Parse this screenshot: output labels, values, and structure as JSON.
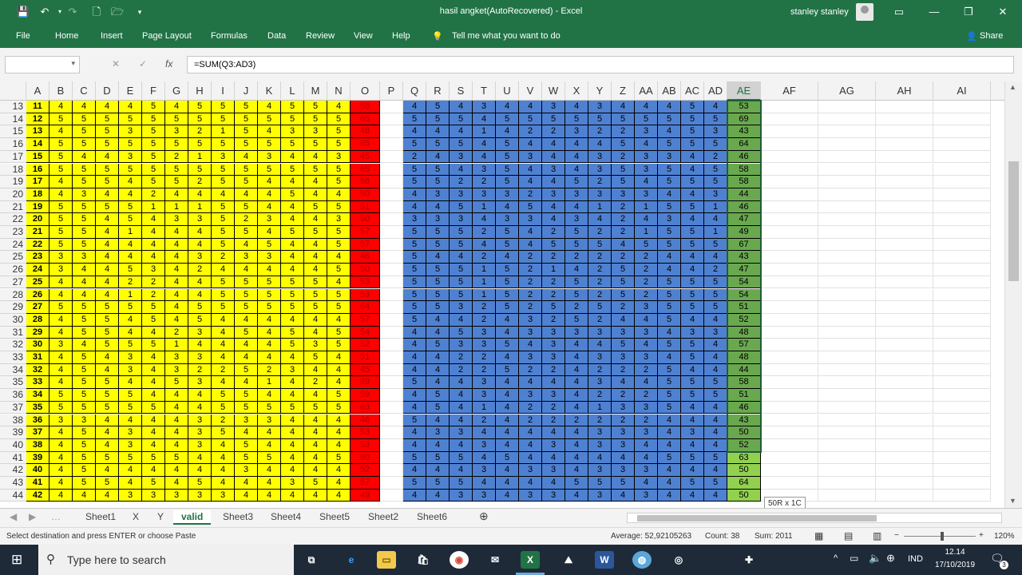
{
  "app": {
    "title": "hasil angket(AutoRecovered)  -  Excel",
    "user": "stanley stanley"
  },
  "ribbon": {
    "tabs": [
      "File",
      "Home",
      "Insert",
      "Page Layout",
      "Formulas",
      "Data",
      "Review",
      "View",
      "Help"
    ],
    "tell_me": "Tell me what you want to do",
    "share": "Share"
  },
  "formula_bar": {
    "name_box": "",
    "formula": "=SUM(Q3:AD3)"
  },
  "columns": [
    "A",
    "B",
    "C",
    "D",
    "E",
    "F",
    "G",
    "H",
    "I",
    "J",
    "K",
    "L",
    "M",
    "N",
    "O",
    "P",
    "Q",
    "R",
    "S",
    "T",
    "U",
    "V",
    "W",
    "X",
    "Y",
    "Z",
    "AA",
    "AB",
    "AC",
    "AD",
    "AE",
    "AF",
    "AG",
    "AH",
    "AI"
  ],
  "selected_column": "AE",
  "rows": [
    {
      "r": "13",
      "id": "11",
      "a": [
        4,
        4,
        4,
        4,
        5,
        4,
        5,
        5,
        5,
        4,
        5,
        5,
        4
      ],
      "o": "58",
      "b": [
        4,
        5,
        4,
        3,
        4,
        4,
        3,
        4,
        3,
        4,
        4,
        4,
        5,
        4
      ],
      "ae": "53"
    },
    {
      "r": "14",
      "id": "12",
      "a": [
        5,
        5,
        5,
        5,
        5,
        5,
        5,
        5,
        5,
        5,
        5,
        5,
        5
      ],
      "o": "65",
      "b": [
        5,
        5,
        5,
        4,
        5,
        5,
        5,
        5,
        5,
        5,
        5,
        5,
        5,
        5
      ],
      "ae": "69"
    },
    {
      "r": "15",
      "id": "13",
      "a": [
        4,
        5,
        5,
        3,
        5,
        3,
        2,
        1,
        5,
        4,
        3,
        3,
        5
      ],
      "o": "48",
      "b": [
        4,
        4,
        4,
        1,
        4,
        2,
        2,
        3,
        2,
        2,
        3,
        4,
        5,
        3
      ],
      "ae": "43"
    },
    {
      "r": "16",
      "id": "14",
      "a": [
        5,
        5,
        5,
        5,
        5,
        5,
        5,
        5,
        5,
        5,
        5,
        5,
        5
      ],
      "o": "65",
      "b": [
        5,
        5,
        5,
        4,
        5,
        4,
        4,
        4,
        4,
        5,
        4,
        5,
        5,
        5
      ],
      "ae": "64"
    },
    {
      "r": "17",
      "id": "15",
      "a": [
        5,
        4,
        4,
        3,
        5,
        2,
        1,
        3,
        4,
        3,
        4,
        4,
        3
      ],
      "o": "45",
      "b": [
        2,
        4,
        3,
        4,
        5,
        3,
        4,
        4,
        3,
        2,
        3,
        3,
        4,
        2
      ],
      "ae": "46"
    },
    {
      "r": "18",
      "id": "16",
      "a": [
        5,
        5,
        5,
        5,
        5,
        5,
        5,
        5,
        5,
        5,
        5,
        5,
        5
      ],
      "o": "65",
      "b": [
        5,
        5,
        4,
        3,
        5,
        4,
        3,
        4,
        3,
        5,
        3,
        5,
        4,
        5
      ],
      "ae": "58"
    },
    {
      "r": "19",
      "id": "17",
      "a": [
        4,
        5,
        5,
        4,
        5,
        5,
        2,
        5,
        5,
        4,
        4,
        4,
        5
      ],
      "o": "58",
      "b": [
        5,
        5,
        2,
        2,
        5,
        4,
        4,
        5,
        2,
        5,
        4,
        5,
        5,
        5
      ],
      "ae": "58"
    },
    {
      "r": "20",
      "id": "18",
      "a": [
        4,
        3,
        4,
        4,
        2,
        4,
        4,
        4,
        4,
        4,
        5,
        4,
        4
      ],
      "o": "50",
      "b": [
        4,
        3,
        3,
        3,
        3,
        2,
        3,
        3,
        3,
        3,
        3,
        4,
        4,
        3
      ],
      "ae": "44"
    },
    {
      "r": "21",
      "id": "19",
      "a": [
        5,
        5,
        5,
        5,
        1,
        1,
        1,
        5,
        5,
        4,
        4,
        5,
        5
      ],
      "o": "51",
      "b": [
        4,
        4,
        5,
        1,
        4,
        5,
        4,
        4,
        1,
        2,
        1,
        5,
        5,
        1
      ],
      "ae": "46"
    },
    {
      "r": "22",
      "id": "20",
      "a": [
        5,
        5,
        4,
        5,
        4,
        3,
        3,
        5,
        2,
        3,
        4,
        4,
        3
      ],
      "o": "50",
      "b": [
        3,
        3,
        3,
        4,
        3,
        3,
        4,
        3,
        4,
        2,
        4,
        3,
        4,
        4
      ],
      "ae": "47"
    },
    {
      "r": "23",
      "id": "21",
      "a": [
        5,
        5,
        4,
        1,
        4,
        4,
        4,
        5,
        5,
        4,
        5,
        5,
        5
      ],
      "o": "57",
      "b": [
        5,
        5,
        5,
        2,
        5,
        4,
        2,
        5,
        2,
        2,
        1,
        5,
        5,
        1
      ],
      "ae": "49"
    },
    {
      "r": "24",
      "id": "22",
      "a": [
        5,
        5,
        4,
        4,
        4,
        4,
        4,
        5,
        4,
        5,
        4,
        4,
        5
      ],
      "o": "57",
      "b": [
        5,
        5,
        5,
        4,
        5,
        4,
        5,
        5,
        5,
        4,
        5,
        5,
        5,
        5
      ],
      "ae": "67"
    },
    {
      "r": "25",
      "id": "23",
      "a": [
        3,
        3,
        4,
        4,
        4,
        4,
        3,
        2,
        3,
        3,
        4,
        4,
        4
      ],
      "o": "46",
      "b": [
        5,
        4,
        4,
        2,
        4,
        2,
        2,
        2,
        2,
        2,
        2,
        4,
        4,
        4
      ],
      "ae": "43"
    },
    {
      "r": "26",
      "id": "24",
      "a": [
        3,
        4,
        4,
        5,
        3,
        4,
        2,
        4,
        4,
        4,
        4,
        4,
        5
      ],
      "o": "50",
      "b": [
        5,
        5,
        5,
        1,
        5,
        2,
        1,
        4,
        2,
        5,
        2,
        4,
        4,
        2
      ],
      "ae": "47"
    },
    {
      "r": "27",
      "id": "25",
      "a": [
        4,
        4,
        4,
        2,
        2,
        4,
        4,
        5,
        5,
        5,
        5,
        5,
        4
      ],
      "o": "53",
      "b": [
        5,
        5,
        5,
        1,
        5,
        2,
        2,
        5,
        2,
        5,
        2,
        5,
        5,
        5
      ],
      "ae": "54"
    },
    {
      "r": "28",
      "id": "26",
      "a": [
        4,
        4,
        4,
        1,
        2,
        4,
        4,
        5,
        5,
        5,
        5,
        5,
        5
      ],
      "o": "53",
      "b": [
        5,
        5,
        5,
        1,
        5,
        2,
        2,
        5,
        2,
        5,
        2,
        5,
        5,
        5
      ],
      "ae": "54"
    },
    {
      "r": "29",
      "id": "27",
      "a": [
        5,
        5,
        5,
        5,
        5,
        4,
        5,
        5,
        5,
        5,
        5,
        5,
        5
      ],
      "o": "64",
      "b": [
        5,
        5,
        3,
        2,
        5,
        2,
        5,
        2,
        5,
        2,
        3,
        5,
        5,
        5
      ],
      "ae": "51"
    },
    {
      "r": "30",
      "id": "28",
      "a": [
        4,
        5,
        5,
        4,
        5,
        4,
        5,
        4,
        4,
        4,
        4,
        4,
        4
      ],
      "o": "57",
      "b": [
        5,
        4,
        4,
        2,
        4,
        3,
        2,
        5,
        2,
        4,
        4,
        5,
        4,
        4
      ],
      "ae": "52"
    },
    {
      "r": "31",
      "id": "29",
      "a": [
        4,
        5,
        5,
        4,
        4,
        2,
        3,
        4,
        5,
        4,
        5,
        4,
        5
      ],
      "o": "54",
      "b": [
        4,
        4,
        5,
        3,
        4,
        3,
        3,
        3,
        3,
        3,
        3,
        4,
        3,
        3
      ],
      "ae": "48"
    },
    {
      "r": "32",
      "id": "30",
      "a": [
        3,
        4,
        5,
        5,
        5,
        1,
        4,
        4,
        4,
        4,
        5,
        3,
        5
      ],
      "o": "52",
      "b": [
        4,
        5,
        3,
        3,
        5,
        4,
        3,
        4,
        4,
        5,
        4,
        5,
        5,
        4
      ],
      "ae": "57"
    },
    {
      "r": "33",
      "id": "31",
      "a": [
        4,
        5,
        4,
        3,
        4,
        3,
        3,
        4,
        4,
        4,
        4,
        5,
        4
      ],
      "o": "51",
      "b": [
        4,
        4,
        2,
        2,
        4,
        3,
        3,
        4,
        3,
        3,
        3,
        4,
        5,
        4
      ],
      "ae": "48"
    },
    {
      "r": "34",
      "id": "32",
      "a": [
        4,
        5,
        4,
        3,
        4,
        3,
        2,
        2,
        5,
        2,
        3,
        4,
        4
      ],
      "o": "45",
      "b": [
        4,
        4,
        2,
        2,
        5,
        2,
        2,
        4,
        2,
        2,
        2,
        5,
        4,
        4
      ],
      "ae": "44"
    },
    {
      "r": "35",
      "id": "33",
      "a": [
        4,
        5,
        5,
        4,
        4,
        5,
        3,
        4,
        4,
        1,
        4,
        2,
        4
      ],
      "o": "49",
      "b": [
        5,
        4,
        4,
        3,
        4,
        4,
        4,
        4,
        3,
        4,
        4,
        5,
        5,
        5
      ],
      "ae": "58"
    },
    {
      "r": "36",
      "id": "34",
      "a": [
        5,
        5,
        5,
        5,
        4,
        4,
        4,
        5,
        5,
        4,
        4,
        4,
        5
      ],
      "o": "59",
      "b": [
        4,
        5,
        4,
        3,
        4,
        3,
        3,
        4,
        2,
        2,
        2,
        5,
        5,
        5
      ],
      "ae": "51"
    },
    {
      "r": "37",
      "id": "35",
      "a": [
        5,
        5,
        5,
        5,
        5,
        4,
        4,
        5,
        5,
        5,
        5,
        5,
        5
      ],
      "o": "63",
      "b": [
        4,
        5,
        4,
        1,
        4,
        2,
        2,
        4,
        1,
        3,
        3,
        5,
        4,
        4
      ],
      "ae": "46"
    },
    {
      "r": "38",
      "id": "36",
      "a": [
        3,
        3,
        4,
        4,
        4,
        4,
        3,
        2,
        3,
        3,
        4,
        4,
        4
      ],
      "o": "46",
      "b": [
        5,
        4,
        4,
        2,
        4,
        2,
        2,
        2,
        2,
        2,
        2,
        4,
        4,
        4
      ],
      "ae": "43"
    },
    {
      "r": "39",
      "id": "37",
      "a": [
        4,
        5,
        4,
        3,
        4,
        4,
        3,
        5,
        4,
        4,
        4,
        4,
        4
      ],
      "o": "53",
      "b": [
        4,
        3,
        3,
        4,
        4,
        4,
        4,
        4,
        3,
        3,
        3,
        4,
        3,
        4
      ],
      "ae": "50"
    },
    {
      "r": "40",
      "id": "38",
      "a": [
        4,
        5,
        4,
        3,
        4,
        4,
        3,
        4,
        5,
        4,
        4,
        4,
        4
      ],
      "o": "53",
      "b": [
        4,
        4,
        4,
        3,
        4,
        4,
        3,
        4,
        3,
        3,
        4,
        4,
        4,
        4
      ],
      "ae": "52"
    },
    {
      "r": "41",
      "id": "39",
      "a": [
        4,
        5,
        5,
        5,
        5,
        5,
        4,
        4,
        5,
        5,
        4,
        4,
        5
      ],
      "o": "60",
      "b": [
        5,
        5,
        5,
        4,
        5,
        4,
        4,
        4,
        4,
        4,
        4,
        5,
        5,
        5
      ],
      "ae": "63"
    },
    {
      "r": "42",
      "id": "40",
      "a": [
        4,
        5,
        4,
        4,
        4,
        4,
        4,
        4,
        3,
        4,
        4,
        4,
        4
      ],
      "o": "52",
      "b": [
        4,
        4,
        4,
        3,
        4,
        3,
        3,
        4,
        3,
        3,
        3,
        4,
        4,
        4
      ],
      "ae": "50"
    },
    {
      "r": "43",
      "id": "41",
      "a": [
        4,
        5,
        5,
        4,
        5,
        4,
        5,
        4,
        4,
        4,
        3,
        5,
        4
      ],
      "o": "57",
      "b": [
        5,
        5,
        5,
        4,
        4,
        4,
        4,
        5,
        5,
        5,
        4,
        4,
        5,
        5
      ],
      "ae": "64"
    },
    {
      "r": "44",
      "id": "42",
      "a": [
        4,
        4,
        4,
        3,
        3,
        3,
        3,
        3,
        4,
        4,
        4,
        4,
        4
      ],
      "o": "49",
      "b": [
        4,
        4,
        3,
        3,
        4,
        3,
        3,
        4,
        3,
        4,
        3,
        4,
        4,
        4
      ],
      "ae": "50"
    }
  ],
  "tooltip": "50R x 1C",
  "sheets": [
    "Sheet1",
    "X",
    "Y",
    "valid",
    "Sheet3",
    "Sheet4",
    "Sheet5",
    "Sheet2",
    "Sheet6"
  ],
  "active_sheet": "valid",
  "status": {
    "message": "Select destination and press ENTER or choose Paste",
    "average": "Average: 52,92105263",
    "count": "Count: 38",
    "sum": "Sum: 2011",
    "zoom": "120%"
  },
  "taskbar": {
    "search_placeholder": "Type here to search",
    "lang": "IND",
    "time": "12.14",
    "date": "17/10/2019",
    "notifications": "3"
  },
  "colors": {
    "excel_green": "#217346",
    "yellow": "#ffff00",
    "red": "#ff0000",
    "blue": "#4f81d2",
    "green": "#6aa84f",
    "light_green": "#92d050"
  }
}
